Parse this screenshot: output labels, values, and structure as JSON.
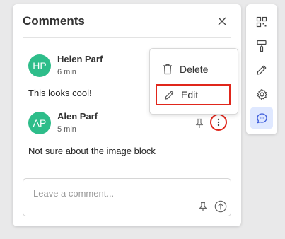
{
  "panel": {
    "title": "Comments",
    "close_icon": "close-icon"
  },
  "comments": [
    {
      "initials": "HP",
      "author": "Helen Parf",
      "time": "6 min",
      "text": "This looks cool!"
    },
    {
      "initials": "AP",
      "author": "Alen Parf",
      "time": "5 min",
      "text": "Not sure about the image block"
    }
  ],
  "menu": {
    "items": [
      {
        "label": "Delete",
        "icon": "trash-icon"
      },
      {
        "label": "Edit",
        "icon": "pencil-icon"
      }
    ]
  },
  "compose": {
    "placeholder": "Leave a comment...",
    "pin_icon": "pin-icon",
    "send_icon": "send-icon"
  },
  "toolbar": {
    "items": [
      "qr-code-icon",
      "paint-roller-icon",
      "pencil-icon",
      "gear-icon",
      "comment-icon"
    ],
    "active": "comment-icon"
  },
  "colors": {
    "avatar": "#2ebd8a",
    "highlight": "#e0261b",
    "active_tool_bg": "#dfe8ff",
    "active_tool_icon": "#3b5bdb"
  }
}
